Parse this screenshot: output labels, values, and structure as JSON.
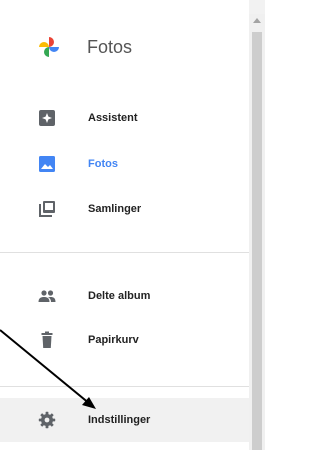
{
  "app": {
    "title": "Fotos"
  },
  "nav": {
    "assistent": "Assistent",
    "fotos": "Fotos",
    "samlinger": "Samlinger",
    "delte_album": "Delte album",
    "papirkurv": "Papirkurv",
    "indstillinger": "Indstillinger"
  },
  "colors": {
    "accent": "#4285f4",
    "icon": "#5f6368",
    "text": "#222222"
  },
  "icons": [
    "photos-pinwheel-icon",
    "assistant-icon",
    "photo-icon",
    "collections-icon",
    "people-icon",
    "trash-icon",
    "gear-icon"
  ]
}
